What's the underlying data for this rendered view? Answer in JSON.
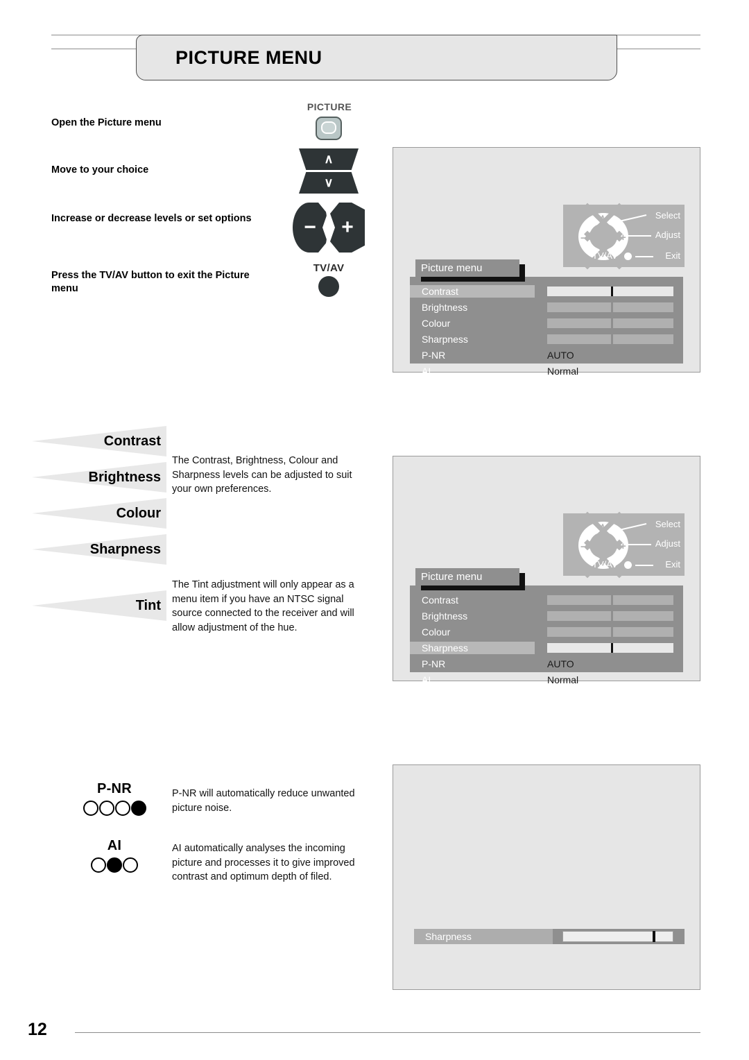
{
  "header": {
    "title": "PICTURE MENU"
  },
  "instructions": [
    {
      "text": "Open the Picture menu"
    },
    {
      "text": "Move to your choice"
    },
    {
      "text": "Increase or decrease levels or set options"
    },
    {
      "text": "Press the TV/AV button to exit the Picture menu"
    }
  ],
  "remote": {
    "picture_label": "PICTURE",
    "up_glyph": "∧",
    "down_glyph": "∨",
    "minus_glyph": "−",
    "plus_glyph": "+",
    "tvav_label": "TV/AV"
  },
  "nav_hint": {
    "select": "Select",
    "adjust": "Adjust",
    "exit": "Exit",
    "tvav": "TV/AV",
    "up_glyph": "∧",
    "down_glyph": "∨",
    "left_glyph": "−",
    "right_glyph": "+"
  },
  "osd": {
    "title": "Picture menu",
    "rows": [
      {
        "label": "Contrast",
        "type": "bar",
        "value": ""
      },
      {
        "label": "Brightness",
        "type": "bar",
        "value": ""
      },
      {
        "label": "Colour",
        "type": "bar",
        "value": ""
      },
      {
        "label": "Sharpness",
        "type": "bar",
        "value": ""
      },
      {
        "label": "P-NR",
        "type": "text",
        "value": "AUTO"
      },
      {
        "label": "AI",
        "type": "text",
        "value": "Normal"
      }
    ],
    "panel1_selected": "Contrast",
    "panel2_selected": "Sharpness"
  },
  "sharpness_bar": {
    "label": "Sharpness"
  },
  "wedges": [
    {
      "label": "Contrast"
    },
    {
      "label": "Brightness"
    },
    {
      "label": "Colour"
    },
    {
      "label": "Sharpness"
    },
    {
      "label": "Tint"
    }
  ],
  "paragraphs": {
    "levels": "The Contrast, Brightness, Colour and Sharpness levels can be adjusted to suit your own preferences.",
    "tint": "The Tint adjustment will only appear as a menu item if you have an NTSC signal source connected to the receiver and will allow adjustment of the hue.",
    "pnr": "P-NR will automatically reduce unwanted picture noise.",
    "ai": "AI automatically analyses the incoming picture and processes it to give improved contrast and optimum depth of filed."
  },
  "pnr": {
    "title": "P-NR",
    "dots": [
      false,
      false,
      false,
      true
    ]
  },
  "ai": {
    "title": "AI",
    "dots": [
      false,
      true,
      false
    ]
  },
  "footer": {
    "page_number": "12"
  },
  "colors": {
    "tab_bg": "#e6e6e6",
    "panel_bg": "#e6e6e6",
    "osd_bg": "#8f8f8f",
    "osd_highlight": "#b8b8b8",
    "nav_hint_bg": "#b3b3b3",
    "key_dark": "#2e3436",
    "wedge_gray": "#e8e8e8"
  }
}
